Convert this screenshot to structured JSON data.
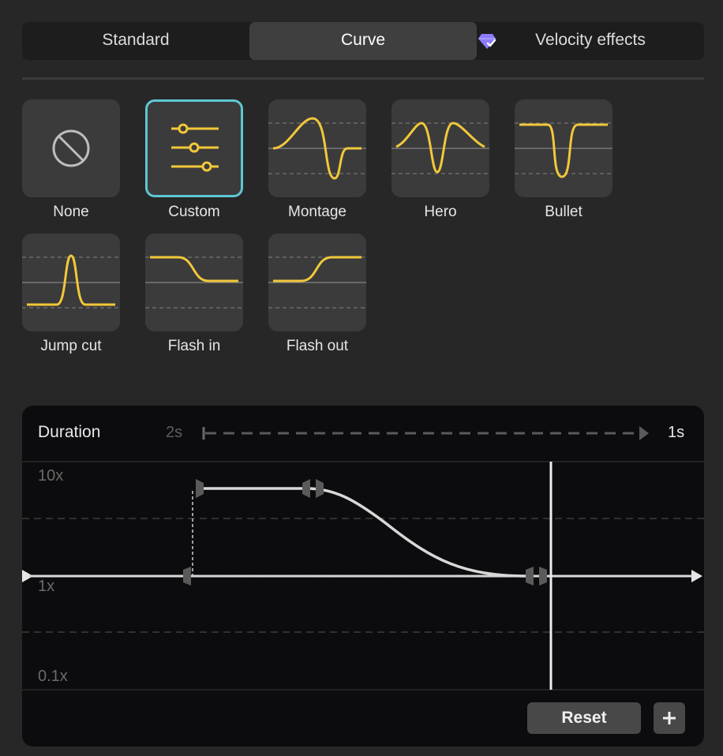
{
  "tabs": [
    {
      "label": "Standard",
      "active": false
    },
    {
      "label": "Curve",
      "active": true
    },
    {
      "label": "Velocity effects",
      "active": false
    }
  ],
  "premium_icon": "diamond-icon",
  "presets": [
    {
      "label": "None",
      "icon": "ban-icon",
      "selected": false
    },
    {
      "label": "Custom",
      "icon": "sliders-icon",
      "selected": true
    },
    {
      "label": "Montage",
      "icon": "curve-montage-icon",
      "selected": false
    },
    {
      "label": "Hero",
      "icon": "curve-hero-icon",
      "selected": false
    },
    {
      "label": "Bullet",
      "icon": "curve-bullet-icon",
      "selected": false
    },
    {
      "label": "Jump cut",
      "icon": "curve-jump-cut-icon",
      "selected": false
    },
    {
      "label": "Flash in",
      "icon": "curve-flash-in-icon",
      "selected": false
    },
    {
      "label": "Flash out",
      "icon": "curve-flash-out-icon",
      "selected": false
    }
  ],
  "editor": {
    "duration_label": "Duration",
    "duration_min": "2s",
    "duration_max": "1s",
    "y_labels": {
      "top": "10x",
      "mid": "1x",
      "bottom": "0.1x"
    },
    "reset_label": "Reset",
    "add_icon": "plus-icon"
  },
  "colors": {
    "accent_curve": "#f2c83a",
    "selected_border": "#5ec7d3",
    "premium_gem": "#8b7cff"
  }
}
